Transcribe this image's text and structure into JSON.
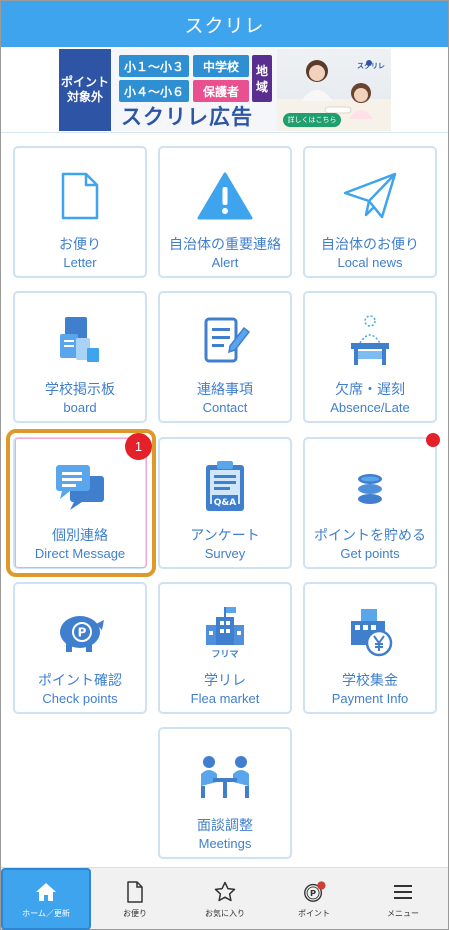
{
  "header": {
    "title": "スクリレ"
  },
  "banner": {
    "left_line1": "ポイント",
    "left_line2": "対象外",
    "tag1": "小１～小３",
    "tag2": "中学校",
    "tag3": "小４～小６",
    "tag4": "保護者",
    "tag5_line1": "地",
    "tag5_line2": "域",
    "title": "スクリレ広告",
    "brand": "スクリレ",
    "more": "詳しくはこちら"
  },
  "tiles": [
    {
      "jp": "お便り",
      "en": "Letter",
      "icon": "document-icon"
    },
    {
      "jp": "自治体の重要連絡",
      "en": "Alert",
      "icon": "warning-icon"
    },
    {
      "jp": "自治体のお便り",
      "en": "Local news",
      "icon": "paper-plane-icon"
    },
    {
      "jp": "学校掲示板",
      "en": "board",
      "icon": "bulletin-board-icon"
    },
    {
      "jp": "連絡事項",
      "en": "Contact",
      "icon": "notepad-pen-icon"
    },
    {
      "jp": "欠席・遅刻",
      "en": "Absence/Late",
      "icon": "desk-person-icon"
    },
    {
      "jp": "個別連絡",
      "en": "Direct Message",
      "icon": "chat-bubbles-icon"
    },
    {
      "jp": "アンケート",
      "en": "Survey",
      "icon": "clipboard-qa-icon"
    },
    {
      "jp": "ポイントを貯める",
      "en": "Get points",
      "icon": "coin-stack-icon"
    },
    {
      "jp": "ポイント確認",
      "en": "Check points",
      "icon": "piggy-bank-icon"
    },
    {
      "jp": "学リレ",
      "en": "Flea market",
      "icon": "flea-market-school-icon"
    },
    {
      "jp": "学校集金",
      "en": "Payment Info",
      "icon": "school-yen-icon"
    },
    {
      "jp": "面談調整",
      "en": "Meetings",
      "icon": "meeting-icon"
    }
  ],
  "badges": {
    "direct_message_count": "1"
  },
  "tabbar": [
    {
      "label": "ホーム／更新",
      "icon": "home-icon",
      "active": true
    },
    {
      "label": "お便り",
      "icon": "document-icon",
      "active": false
    },
    {
      "label": "お気に入り",
      "icon": "star-icon",
      "active": false
    },
    {
      "label": "ポイント",
      "icon": "point-coin-icon",
      "active": false
    },
    {
      "label": "メニュー",
      "icon": "hamburger-icon",
      "active": false
    }
  ],
  "colors": {
    "primary": "#3fa4ee",
    "icon_blue": "#3f7fce",
    "badge_red": "#e4202a",
    "focus_ring": "#dd9a2a"
  },
  "misc": {
    "flea_icon_text": "フリマ",
    "qa_icon_text": "Q&A",
    "point_icon_text": "P"
  }
}
